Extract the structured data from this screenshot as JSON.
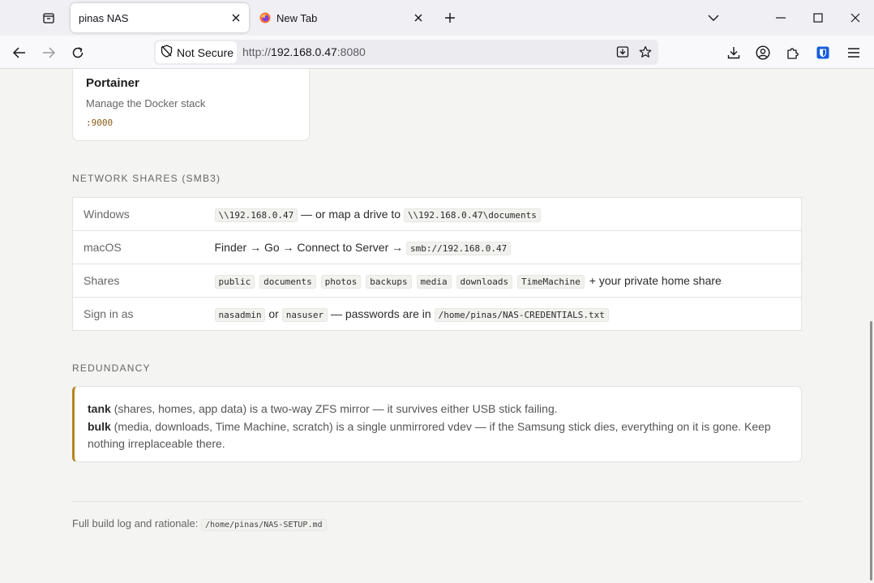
{
  "browser": {
    "tabs": [
      {
        "title": "pinas NAS",
        "active": true
      },
      {
        "title": "New Tab",
        "active": false
      }
    ],
    "security_label": "Not Secure",
    "url": {
      "prefix": "http://",
      "host": "192.168.0.47",
      "port": ":8080"
    }
  },
  "card": {
    "title": "Portainer",
    "description": "Manage the Docker stack",
    "port": ":9000"
  },
  "network_shares": {
    "heading": "NETWORK SHARES (SMB3)",
    "rows": {
      "windows": {
        "label": "Windows",
        "path1": "\\\\192.168.0.47",
        "mid": "— or map a drive to",
        "path2": "\\\\192.168.0.47\\documents"
      },
      "macos": {
        "label": "macOS",
        "text": "Finder → Go → Connect to Server →",
        "path": "smb://192.168.0.47"
      },
      "shares": {
        "label": "Shares",
        "items": [
          "public",
          "documents",
          "photos",
          "backups",
          "media",
          "downloads",
          "TimeMachine"
        ],
        "suffix": "+ your private home share"
      },
      "signin": {
        "label": "Sign in as",
        "user1": "nasadmin",
        "or": "or",
        "user2": "nasuser",
        "mid": "— passwords are in",
        "path": "/home/pinas/NAS-CREDENTIALS.txt"
      }
    }
  },
  "redundancy": {
    "heading": "REDUNDANCY",
    "tank_name": "tank",
    "tank_text": "(shares, homes, app data) is a two-way ZFS mirror — it survives either USB stick failing.",
    "bulk_name": "bulk",
    "bulk_text": "(media, downloads, Time Machine, scratch) is a single unmirrored vdev — if the Samsung stick dies, everything on it is gone. Keep nothing irreplaceable there."
  },
  "footer": {
    "label": "Full build log and rationale:",
    "path": "/home/pinas/NAS-SETUP.md"
  },
  "colors": {
    "accent": "#b5841e",
    "port": "#8a5a14",
    "background": "#f4f4f2"
  }
}
